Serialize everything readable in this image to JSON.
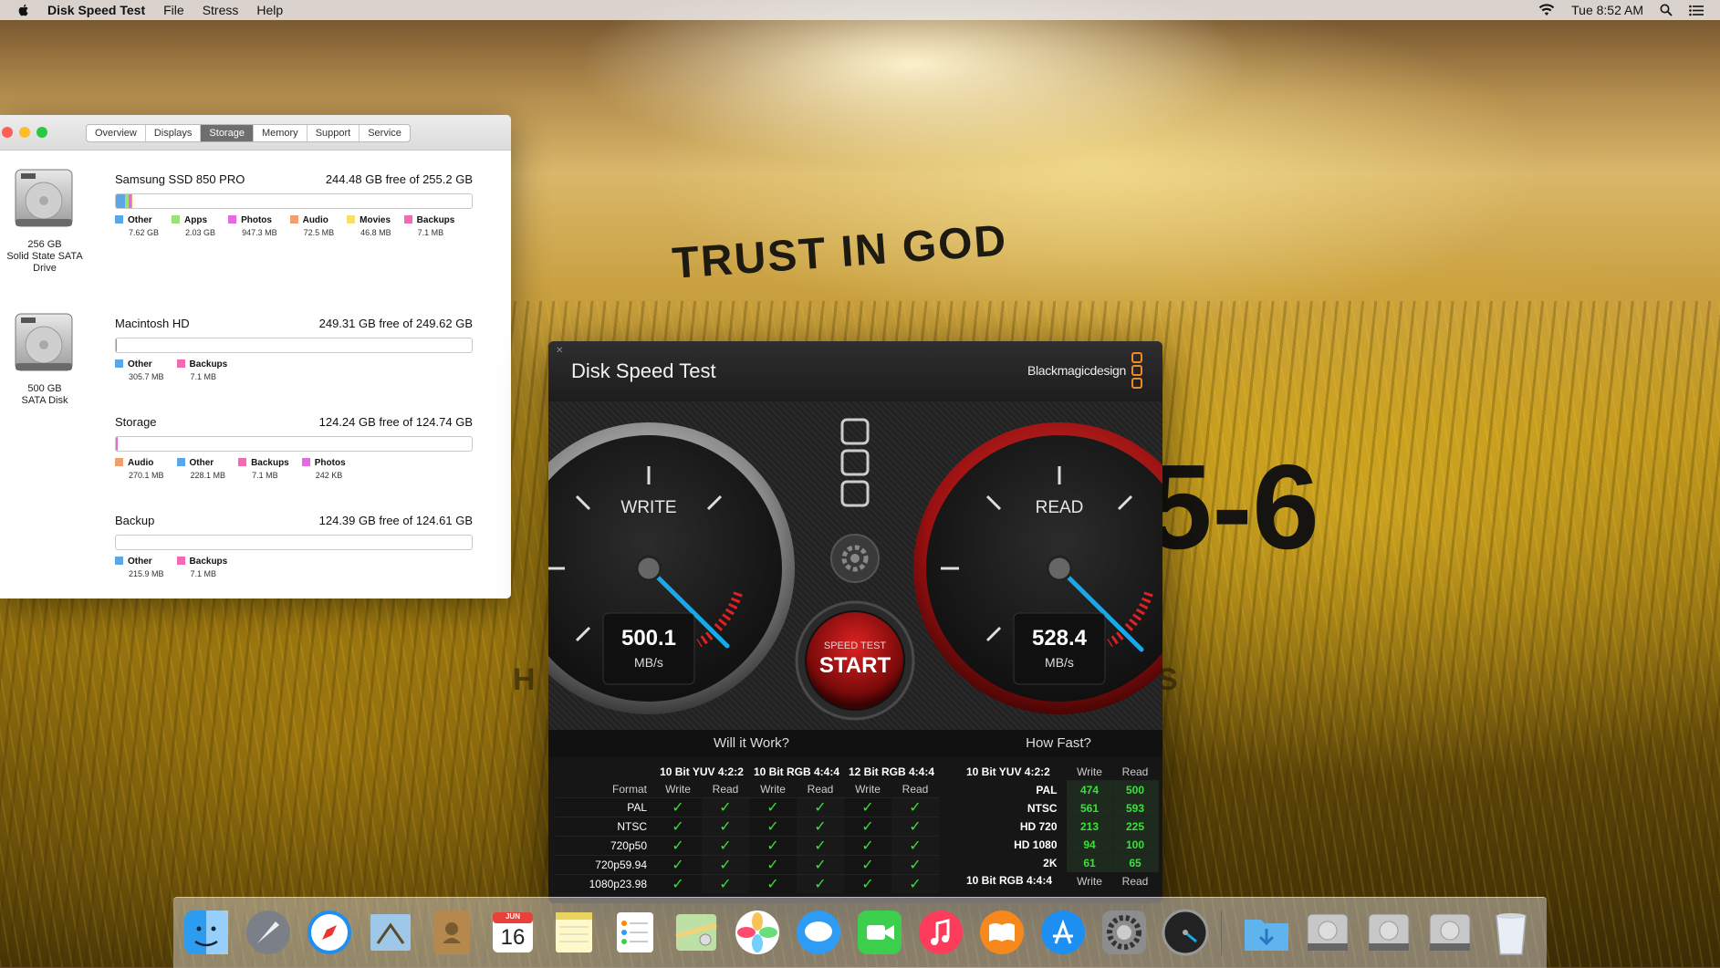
{
  "menubar": {
    "app_name": "Disk Speed Test",
    "menus": [
      "File",
      "Stress",
      "Help"
    ],
    "clock": "Tue 8:52 AM"
  },
  "sysinfo": {
    "tabs": [
      "Overview",
      "Displays",
      "Storage",
      "Memory",
      "Support",
      "Service"
    ],
    "active_tab": "Storage",
    "disks": [
      {
        "caption": [
          "256 GB",
          "Solid State SATA",
          "Drive"
        ],
        "volumes": [
          {
            "name": "Samsung SSD 850 PRO",
            "free": "244.48 GB free of 255.2 GB",
            "legend": [
              {
                "label": "Other",
                "size": "7.62 GB",
                "color": "#5aa6e6"
              },
              {
                "label": "Apps",
                "size": "2.03 GB",
                "color": "#9de07a"
              },
              {
                "label": "Photos",
                "size": "947.3 MB",
                "color": "#e46ae0"
              },
              {
                "label": "Audio",
                "size": "72.5 MB",
                "color": "#f0a070"
              },
              {
                "label": "Movies",
                "size": "46.8 MB",
                "color": "#f4e06a"
              },
              {
                "label": "Backups",
                "size": "7.1 MB",
                "color": "#f06ab4"
              }
            ]
          }
        ]
      },
      {
        "caption": [
          "500 GB",
          "SATA Disk"
        ],
        "volumes": [
          {
            "name": "Macintosh HD",
            "free": "249.31 GB free of 249.62 GB",
            "legend": [
              {
                "label": "Other",
                "size": "305.7 MB",
                "color": "#5aa6e6"
              },
              {
                "label": "Backups",
                "size": "7.1 MB",
                "color": "#f06ab4"
              }
            ]
          },
          {
            "name": "Storage",
            "free": "124.24 GB free of 124.74 GB",
            "legend": [
              {
                "label": "Audio",
                "size": "270.1 MB",
                "color": "#f0a070"
              },
              {
                "label": "Other",
                "size": "228.1 MB",
                "color": "#5aa6e6"
              },
              {
                "label": "Backups",
                "size": "7.1 MB",
                "color": "#f06ab4"
              },
              {
                "label": "Photos",
                "size": "242 KB",
                "color": "#e46ae0"
              }
            ]
          },
          {
            "name": "Backup",
            "free": "124.39 GB free of 124.61 GB",
            "legend": [
              {
                "label": "Other",
                "size": "215.9 MB",
                "color": "#5aa6e6"
              },
              {
                "label": "Backups",
                "size": "7.1 MB",
                "color": "#f06ab4"
              }
            ]
          }
        ]
      }
    ]
  },
  "wallpaper": {
    "trust_text": "TRUST IN GOD",
    "big_text": "5-6",
    "left_fragment": "H",
    "right_fragment": "S"
  },
  "speedtest": {
    "title": "Disk Speed Test",
    "brand": "Blackmagicdesign",
    "write": {
      "label": "WRITE",
      "value": "500.1",
      "unit": "MB/s"
    },
    "read": {
      "label": "READ",
      "value": "528.4",
      "unit": "MB/s"
    },
    "start_button": {
      "small": "SPEED TEST",
      "big": "START"
    },
    "will_it_work": "Will it Work?",
    "how_fast": "How Fast?",
    "format_header": "Format",
    "codec_groups": [
      "10 Bit YUV 4:2:2",
      "10 Bit RGB 4:4:4",
      "12 Bit RGB 4:4:4"
    ],
    "write_label": "Write",
    "read_label": "Read",
    "formats": [
      "PAL",
      "NTSC",
      "720p50",
      "720p59.94",
      "1080p23.98"
    ],
    "check": "✓",
    "speed_group1": "10 Bit YUV 4:2:2",
    "speed_rows": [
      {
        "name": "PAL",
        "write": "474",
        "read": "500"
      },
      {
        "name": "NTSC",
        "write": "561",
        "read": "593"
      },
      {
        "name": "HD 720",
        "write": "213",
        "read": "225"
      },
      {
        "name": "HD 1080",
        "write": "94",
        "read": "100"
      },
      {
        "name": "2K",
        "write": "61",
        "read": "65"
      }
    ],
    "speed_group2": "10 Bit RGB 4:4:4"
  },
  "dock": {
    "calendar_month": "JUN",
    "calendar_day": "16"
  }
}
